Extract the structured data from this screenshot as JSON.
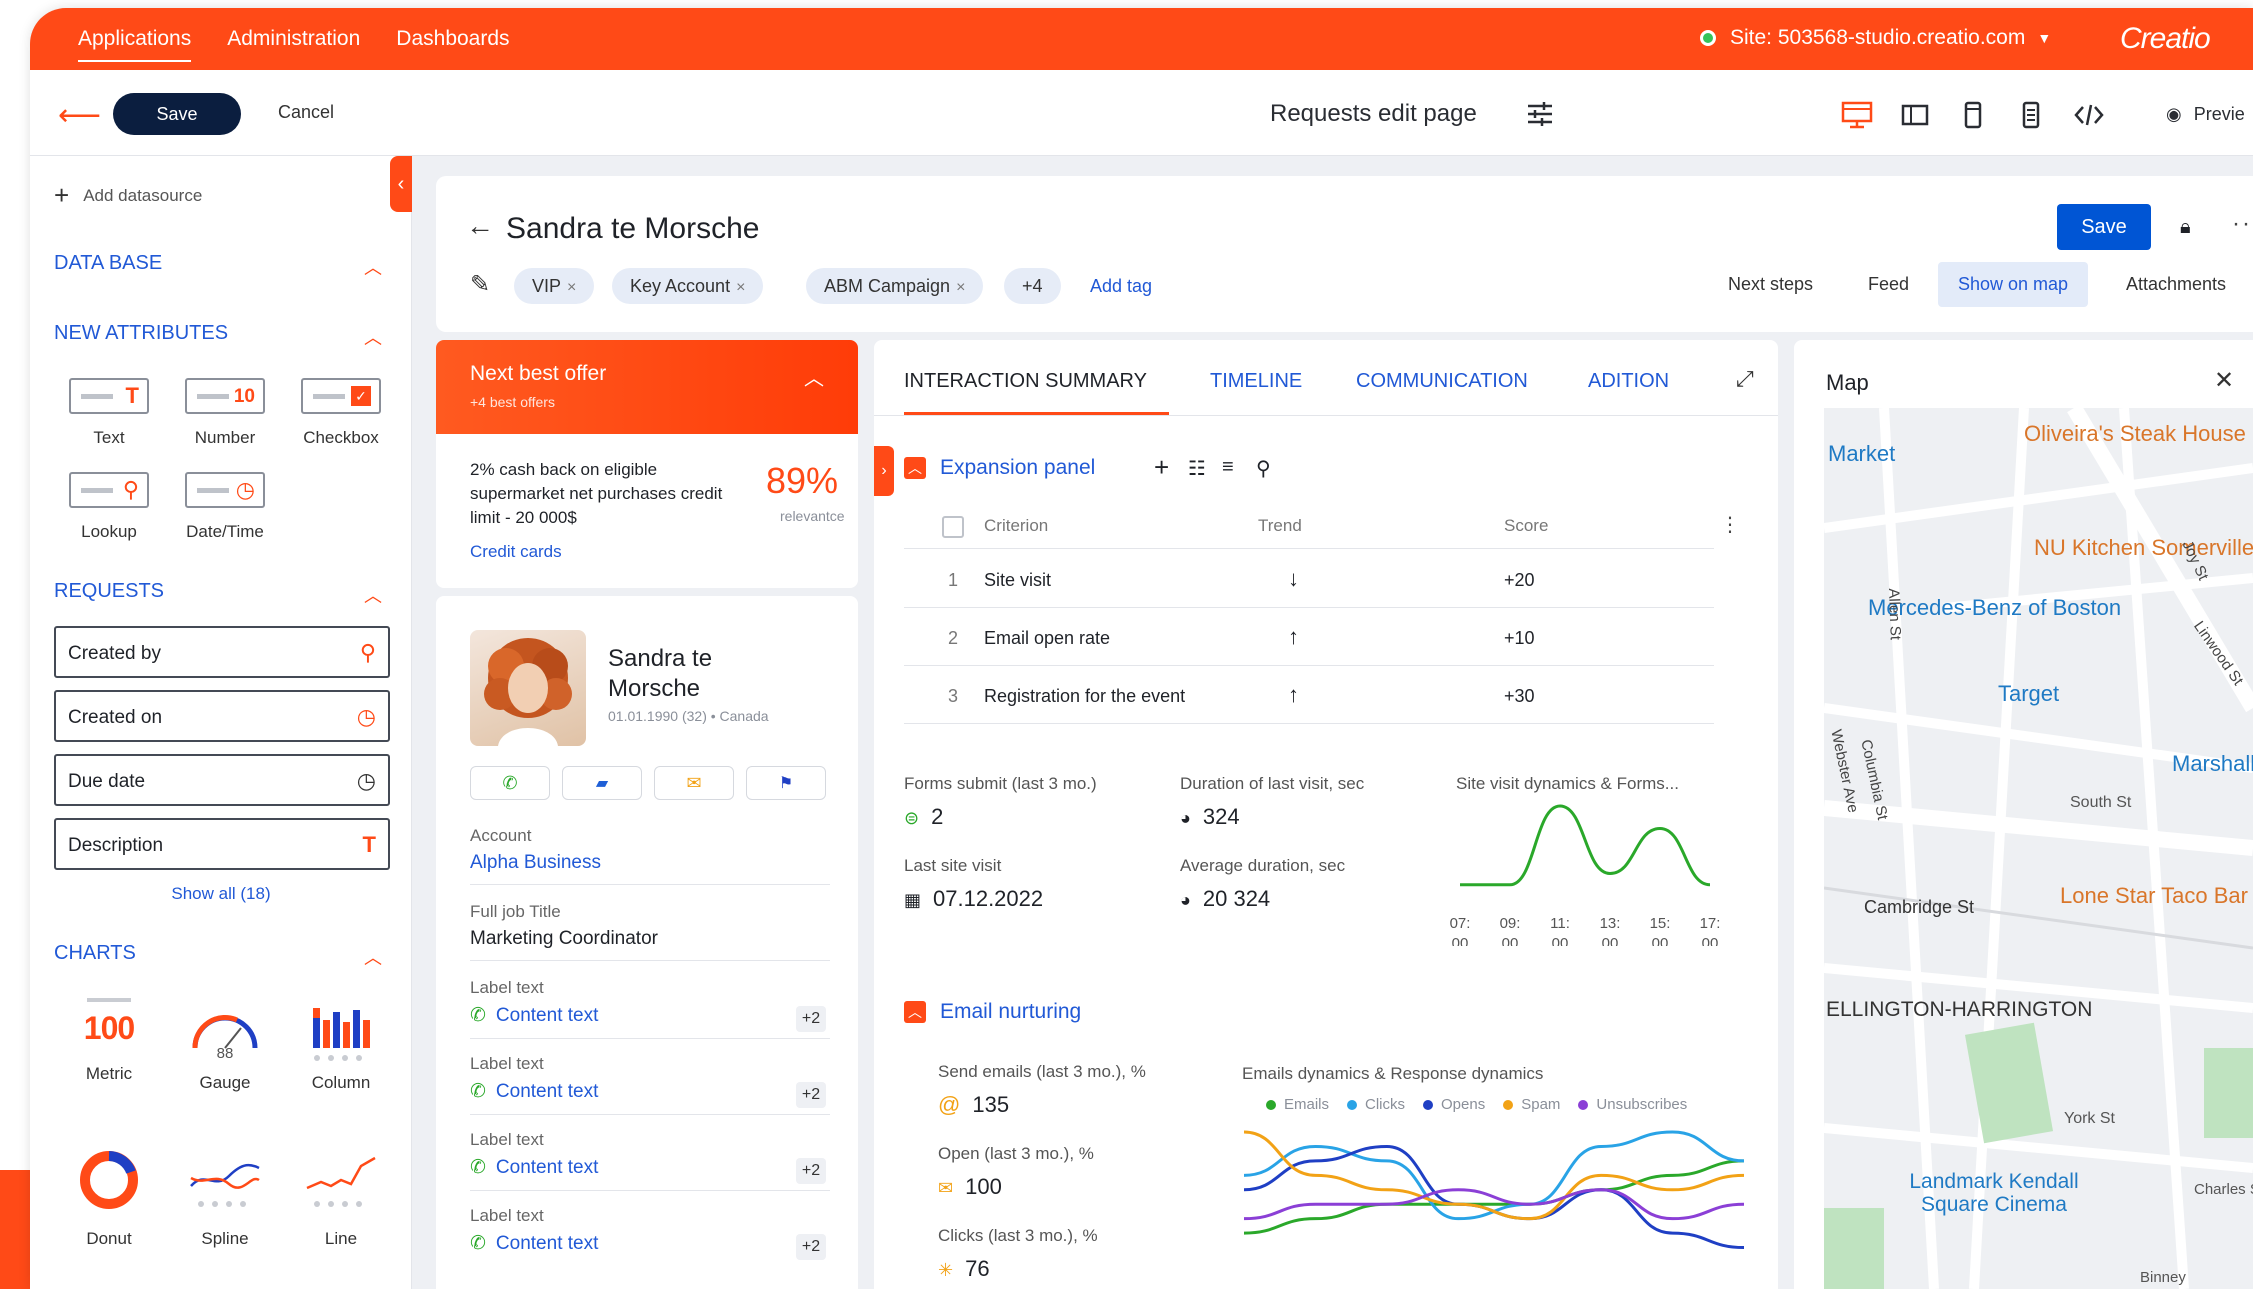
{
  "topbar": {
    "nav": [
      "Applications",
      "Administration",
      "Dashboards"
    ],
    "site": "Site: 503568-studio.creatio.com",
    "brand": "Creatio"
  },
  "toolbar": {
    "save_label": "Save",
    "cancel_label": "Cancel",
    "page_title": "Requests edit page",
    "preview_label": "Previe"
  },
  "left": {
    "add_datasource": "Add datasource",
    "sections": {
      "database": "DATA BASE",
      "new_attributes": "NEW ATTRIBUTES",
      "requests": "REQUESTS",
      "charts": "CHARTS"
    },
    "attributes": [
      {
        "label": "Text",
        "symbol": "T"
      },
      {
        "label": "Number",
        "symbol": "10"
      },
      {
        "label": "Checkbox",
        "symbol": "✓"
      },
      {
        "label": "Lookup",
        "symbol": "⚲"
      },
      {
        "label": "Date/Time",
        "symbol": "◷"
      }
    ],
    "fields": [
      {
        "label": "Created by",
        "icon": "search-icon"
      },
      {
        "label": "Created on",
        "icon": "calendar-clock-icon"
      },
      {
        "label": "Due date",
        "icon": "calendar-clock-icon"
      },
      {
        "label": "Description",
        "icon": "text-icon"
      }
    ],
    "show_all": "Show all (18)",
    "charts": [
      {
        "label": "Metric",
        "value": "100"
      },
      {
        "label": "Gauge",
        "value": "88"
      },
      {
        "label": "Column"
      },
      {
        "label": "Donut"
      },
      {
        "label": "Spline"
      },
      {
        "label": "Line"
      }
    ]
  },
  "record": {
    "name": "Sandra te Morsche",
    "tags": [
      "VIP",
      "Key Account",
      "ABM Campaign",
      "+4"
    ],
    "add_tag": "Add tag",
    "save_label": "Save",
    "tabs": [
      "Next steps",
      "Feed",
      "Show on map",
      "Attachments"
    ]
  },
  "nbo": {
    "title": "Next best offer",
    "subtitle": "+4 best offers",
    "text": "2% cash back on eligible supermarket net purchases credit limit - 20 000$",
    "percent": "89%",
    "relevance": "relevantce",
    "link": "Credit cards"
  },
  "contact": {
    "name": "Sandra te Morsche",
    "meta": "01.01.1990 (32) • Canada",
    "account_label": "Account",
    "account_value": "Alpha Business",
    "job_label": "Full job Title",
    "job_value": "Marketing Coordinator",
    "label_rows": [
      {
        "label": "Label text",
        "value": "Content text",
        "badge": "+2"
      },
      {
        "label": "Label text",
        "value": "Content text",
        "badge": "+2"
      },
      {
        "label": "Label text",
        "value": "Content text",
        "badge": "+2"
      },
      {
        "label": "Label text",
        "value": "Content text",
        "badge": "+2"
      }
    ]
  },
  "main": {
    "tabs": [
      "INTERACTION SUMMARY",
      "TIMELINE",
      "COMMUNICATION",
      "ADITION"
    ],
    "expansion_panel": "Expansion panel",
    "columns": {
      "criterion": "Criterion",
      "trend": "Trend",
      "score": "Score"
    },
    "rows": [
      {
        "n": "1",
        "criterion": "Site visit",
        "trend": "↓",
        "score": "+20"
      },
      {
        "n": "2",
        "criterion": "Email open rate",
        "trend": "↑",
        "score": "+10"
      },
      {
        "n": "3",
        "criterion": "Registration for the event",
        "trend": "↑",
        "score": "+30"
      }
    ],
    "stats": {
      "forms_label": "Forms submit (last 3 mo.)",
      "forms_value": "2",
      "duration_label": "Duration of last visit, sec",
      "duration_value": "324",
      "last_visit_label": "Last site visit",
      "last_visit_value": "07.12.2022",
      "avg_label": "Average duration, sec",
      "avg_value": "20 324",
      "site_chart_title": "Site visit dynamics & Forms..."
    },
    "email_panel": "Email nurturing",
    "email_stats": {
      "send_label": "Send emails (last 3 mo.), %",
      "send_value": "135",
      "open_label": "Open (last 3 mo.), %",
      "open_value": "100",
      "clicks_label": "Clicks (last 3 mo.), %",
      "clicks_value": "76",
      "chart_title": "Emails dynamics & Response dynamics"
    }
  },
  "chart_data": [
    {
      "type": "line",
      "title": "Site visit dynamics & Forms...",
      "categories": [
        "07:00",
        "09:00",
        "11:00",
        "13:00",
        "15:00",
        "17:00"
      ],
      "series": [
        {
          "values": [
            1,
            1,
            8,
            2,
            6,
            1
          ]
        }
      ],
      "color": "#2aa82a"
    },
    {
      "type": "line",
      "title": "Emails dynamics & Response dynamics",
      "series": [
        {
          "name": "Emails",
          "color": "#2aa82a",
          "values": [
            2,
            3,
            4,
            4,
            4,
            5,
            6,
            7
          ]
        },
        {
          "name": "Clicks",
          "color": "#29a3e6",
          "values": [
            6,
            8,
            7,
            3,
            4,
            8,
            9,
            7
          ]
        },
        {
          "name": "Opens",
          "color": "#1f3fc4",
          "values": [
            5,
            7,
            8,
            4,
            3,
            5,
            2,
            1
          ]
        },
        {
          "name": "Spam",
          "color": "#f2a216",
          "values": [
            9,
            6,
            5,
            4,
            3,
            6,
            5,
            6
          ]
        },
        {
          "name": "Unsubscribes",
          "color": "#8b3fd6",
          "values": [
            3,
            4,
            4,
            5,
            4,
            5,
            3,
            4
          ]
        }
      ]
    }
  ],
  "map": {
    "title": "Map",
    "labels": [
      "Oliveira's Steak House",
      "Market",
      "NU Kitchen Somerville",
      "Mercedes-Benz of Boston",
      "Target",
      "Marshalls",
      "South St",
      "Cambridge St",
      "Lone Star Taco Bar",
      "ELLINGTON-HARRINGTON",
      "York St",
      "Landmark Kendall Square Cinema",
      "Charles St",
      "Webster Ave",
      "Columbia St",
      "Joy St",
      "Linwood St",
      "Allen St",
      "Binney"
    ]
  }
}
